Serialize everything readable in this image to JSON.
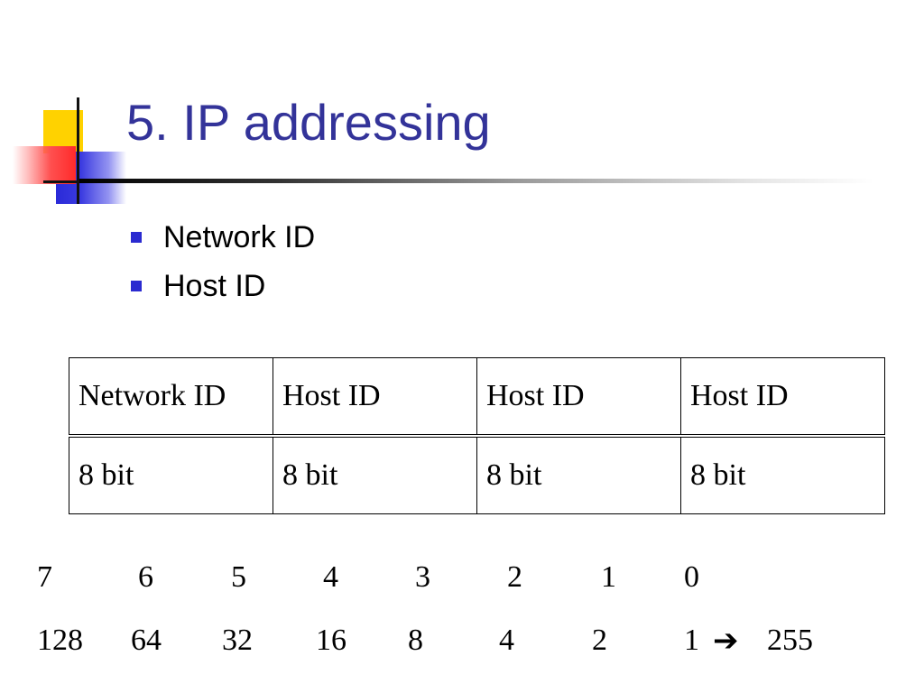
{
  "slide": {
    "title": "5. IP addressing",
    "bullets": [
      {
        "label": "Network ID"
      },
      {
        "label": "Host ID"
      }
    ]
  },
  "table": {
    "header": [
      "Network ID",
      "Host ID",
      "Host ID",
      "Host ID"
    ],
    "row": [
      "8 bit",
      "8 bit",
      "8 bit",
      "8 bit"
    ]
  },
  "bit_positions": [
    "7",
    "6",
    "5",
    "4",
    "3",
    "2",
    "1",
    "0"
  ],
  "bit_values": [
    "128",
    "64",
    "32",
    "16",
    "8",
    "4",
    "2",
    "1"
  ],
  "total": {
    "arrow_icon": "arrow-right-icon",
    "value": "255"
  },
  "colors": {
    "title": "#333399",
    "bullet": "#2a2ad0",
    "logo_yellow": "#ffd200",
    "logo_blue": "#2a2ad8",
    "logo_red": "#ff2a2a"
  }
}
